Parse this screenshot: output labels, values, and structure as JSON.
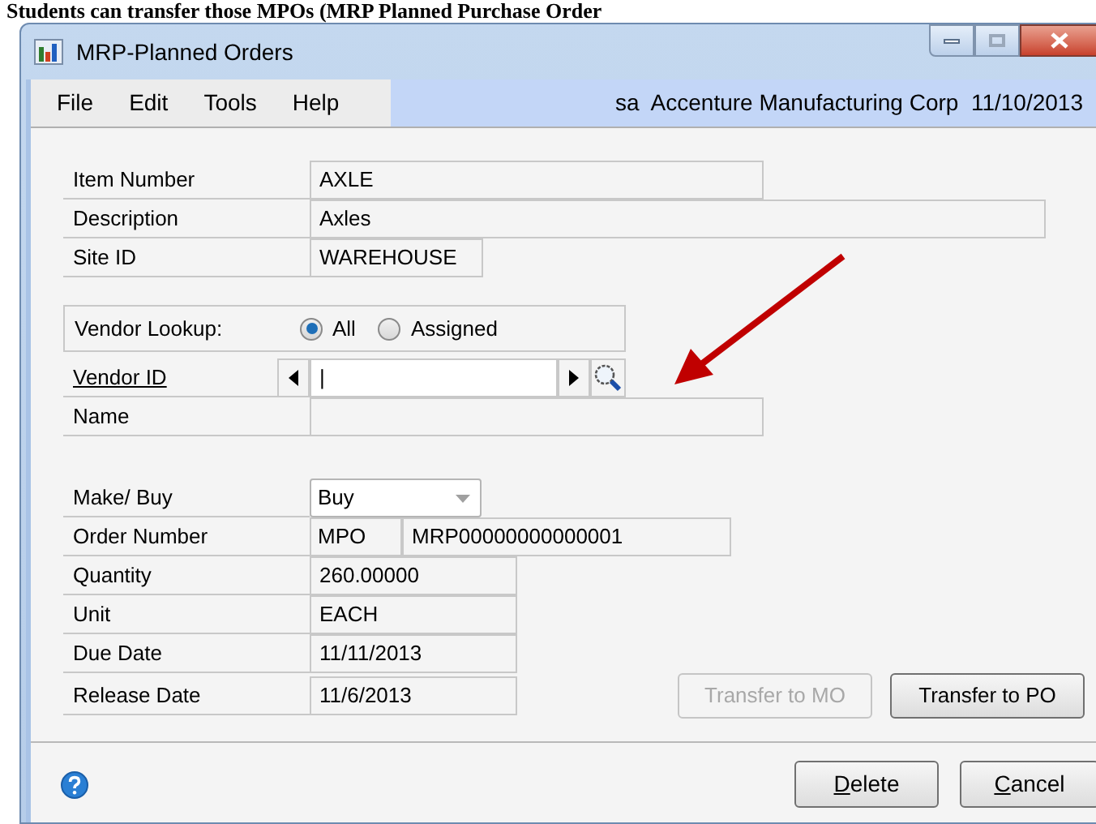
{
  "document_text": "Students can transfer those MPOs (MRP Planned Purchase Order",
  "window": {
    "title": "MRP-Planned Orders"
  },
  "menu": [
    "File",
    "Edit",
    "Tools",
    "Help"
  ],
  "user_info": "sa  Accenture Manufacturing Corp  11/10/2013",
  "item_fields": [
    {
      "label": "Item Number",
      "value": "AXLE"
    },
    {
      "label": "Description",
      "value": "Axles"
    },
    {
      "label": "Site ID",
      "value": "WAREHOUSE"
    }
  ],
  "vendor_lookup": {
    "label": "Vendor Lookup:",
    "options": [
      {
        "label": "All",
        "selected": true
      },
      {
        "label": "Assigned",
        "selected": false
      }
    ]
  },
  "vendor_id": {
    "label": "Vendor ID",
    "value": "|"
  },
  "vendor_name": {
    "label": "Name"
  },
  "order_fields": [
    {
      "kind": "dropdown",
      "label": "Make/ Buy",
      "value": "Buy"
    },
    {
      "kind": "split",
      "label": "Order Number",
      "prefix": "MPO",
      "value": "MRP00000000000001"
    },
    {
      "kind": "text",
      "label": "Quantity",
      "value": "260.00000"
    },
    {
      "kind": "text",
      "label": "Unit",
      "value": "EACH"
    },
    {
      "kind": "text",
      "label": "Due Date",
      "value": "11/11/2013"
    },
    {
      "kind": "text",
      "label": "Release Date",
      "value": "11/6/2013"
    }
  ],
  "transfer_buttons": [
    {
      "label": "Transfer to MO",
      "disabled": true
    },
    {
      "label": "Transfer to PO",
      "disabled": false
    }
  ],
  "footer_buttons": [
    "Delete",
    "Cancel"
  ]
}
